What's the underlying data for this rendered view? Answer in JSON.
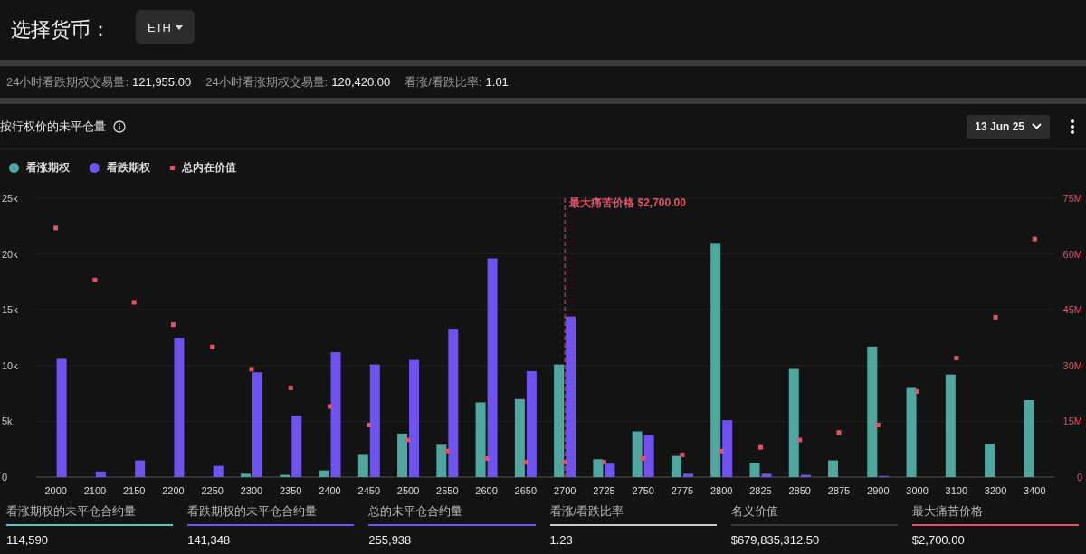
{
  "header": {
    "title": "选择货币：",
    "currency": "ETH"
  },
  "stats": [
    {
      "label": "24小时看跌期权交易量:",
      "value": "121,955.00"
    },
    {
      "label": "24小时看涨期权交易量:",
      "value": "120,420.00"
    },
    {
      "label": "看涨/看跌比率:",
      "value": "1.01"
    }
  ],
  "section": {
    "title": "按行权价的未平仓量",
    "date": "13 Jun 25"
  },
  "chart_data": {
    "type": "bar",
    "grid": true,
    "categories": [
      "2000",
      "2100",
      "2150",
      "2200",
      "2250",
      "2300",
      "2350",
      "2400",
      "2450",
      "2500",
      "2550",
      "2600",
      "2650",
      "2700",
      "2725",
      "2750",
      "2775",
      "2800",
      "2825",
      "2850",
      "2875",
      "2900",
      "3000",
      "3100",
      "3200",
      "3400"
    ],
    "series": [
      {
        "name": "看涨期权",
        "color": "#4ea8a0",
        "type": "bar",
        "values": [
          null,
          null,
          null,
          null,
          null,
          300,
          200,
          600,
          2000,
          3900,
          2900,
          6700,
          7000,
          10100,
          1600,
          4100,
          1900,
          21000,
          1300,
          9700,
          1500,
          11700,
          8000,
          9200,
          3000,
          6900
        ]
      },
      {
        "name": "看跌期权",
        "color": "#6f52f0",
        "type": "bar",
        "values": [
          10600,
          500,
          1500,
          12500,
          1000,
          9400,
          5500,
          11200,
          10100,
          10500,
          13300,
          19600,
          9500,
          14400,
          1200,
          3800,
          300,
          5100,
          300,
          200,
          null,
          100,
          null,
          null,
          null,
          null
        ]
      },
      {
        "name": "总内在价值",
        "color": "#e0546a",
        "type": "scatter",
        "axis": "y2",
        "values": [
          67,
          53,
          47,
          41,
          35,
          29,
          24,
          19,
          14,
          10,
          7,
          5,
          4,
          4,
          4,
          5,
          6,
          7,
          8,
          10,
          12,
          14,
          23,
          32,
          43,
          64
        ]
      }
    ],
    "ylim": [
      0,
      25000
    ],
    "yticks": [
      {
        "value": 0,
        "label": "0"
      },
      {
        "value": 5000,
        "label": "5k"
      },
      {
        "value": 10000,
        "label": "10k"
      },
      {
        "value": 15000,
        "label": "15k"
      },
      {
        "value": 20000,
        "label": "20k"
      },
      {
        "value": 25000,
        "label": "25k"
      }
    ],
    "y2lim": [
      0,
      75
    ],
    "y2ticks": [
      {
        "value": 0,
        "label": "0"
      },
      {
        "value": 15,
        "label": "15M"
      },
      {
        "value": 30,
        "label": "30M"
      },
      {
        "value": 45,
        "label": "45M"
      },
      {
        "value": 60,
        "label": "60M"
      },
      {
        "value": 75,
        "label": "75M"
      }
    ],
    "ref_lines": [
      {
        "axis": "x",
        "value": "2700",
        "color": "#e0546a",
        "label": "最大痛苦价格 $2,700.00"
      }
    ]
  },
  "summary": [
    {
      "label": "看涨期权的未平仓合约量",
      "value": "114,590",
      "color": "#5ec8b8"
    },
    {
      "label": "看跌期权的未平仓合约量",
      "value": "141,348",
      "color": "#6f52f0"
    },
    {
      "label": "总的未平仓合约量",
      "value": "255,938",
      "color": "#6f52f0"
    },
    {
      "label": "看涨/看跌比率",
      "value": "1.23",
      "color": "#c8c8c8"
    },
    {
      "label": "名义价值",
      "value": "$679,835,312.50",
      "color": "#3a3a3e"
    },
    {
      "label": "最大痛苦价格",
      "value": "$2,700.00",
      "color": "#e0546a"
    }
  ]
}
